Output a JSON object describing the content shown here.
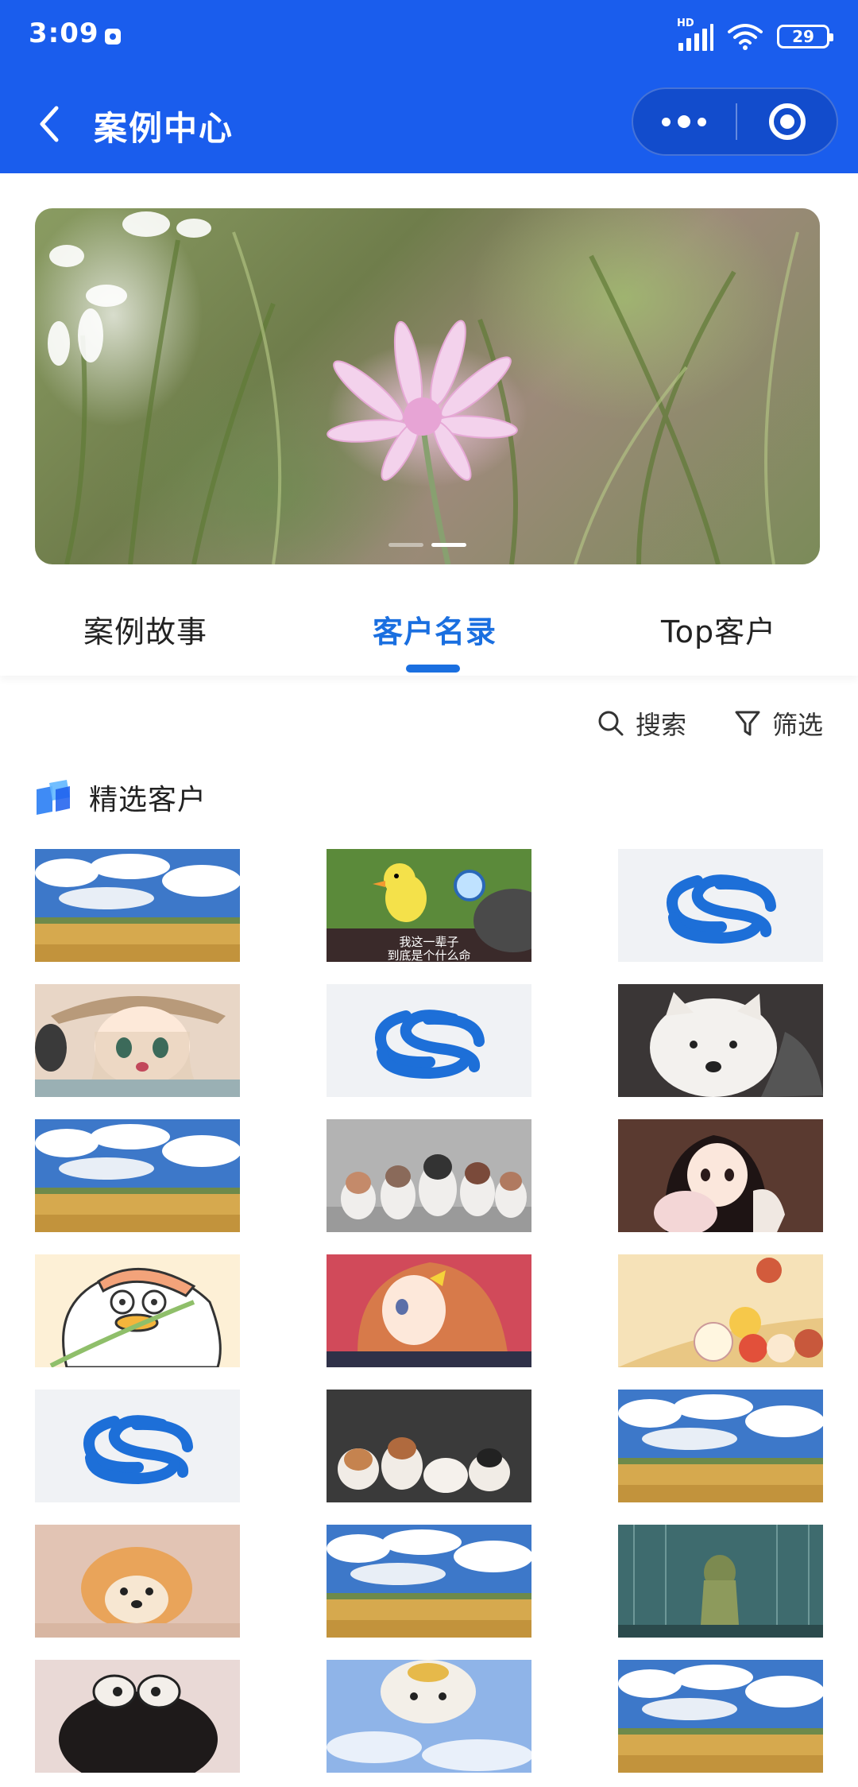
{
  "status_bar": {
    "time": "3:09",
    "signal_label": "HD",
    "battery": "29"
  },
  "header": {
    "title": "案例中心",
    "background": "#1a5ded"
  },
  "banner": {
    "slides": 2,
    "active_slide": 2
  },
  "tabs": [
    {
      "label": "案例故事",
      "active": false
    },
    {
      "label": "客户名录",
      "active": true
    },
    {
      "label": "Top客户",
      "active": false
    }
  ],
  "toolbar": {
    "search_label": "搜索",
    "filter_label": "筛选"
  },
  "section": {
    "title": "精选客户"
  },
  "grid": {
    "items": [
      {
        "kind": "field-landscape"
      },
      {
        "kind": "duck-meme",
        "caption_line1": "我这一辈子",
        "caption_line2": "到底是个什么命"
      },
      {
        "kind": "blue-s-logo"
      },
      {
        "kind": "anime-girl-hat"
      },
      {
        "kind": "blue-s-logo"
      },
      {
        "kind": "white-puppy"
      },
      {
        "kind": "field-landscape"
      },
      {
        "kind": "husky-puppies"
      },
      {
        "kind": "anime-girl-dark-hair"
      },
      {
        "kind": "cartoon-duck"
      },
      {
        "kind": "anime-girl-orange-hair"
      },
      {
        "kind": "cartoon-characters"
      },
      {
        "kind": "blue-s-logo"
      },
      {
        "kind": "corgi-puppies"
      },
      {
        "kind": "field-landscape"
      },
      {
        "kind": "pomeranian"
      },
      {
        "kind": "field-landscape"
      },
      {
        "kind": "anime-rain-scene"
      },
      {
        "kind": "black-sheep-toy"
      },
      {
        "kind": "upside-down-dog"
      },
      {
        "kind": "field-landscape"
      }
    ]
  },
  "colors": {
    "accent": "#1a6fe0"
  }
}
